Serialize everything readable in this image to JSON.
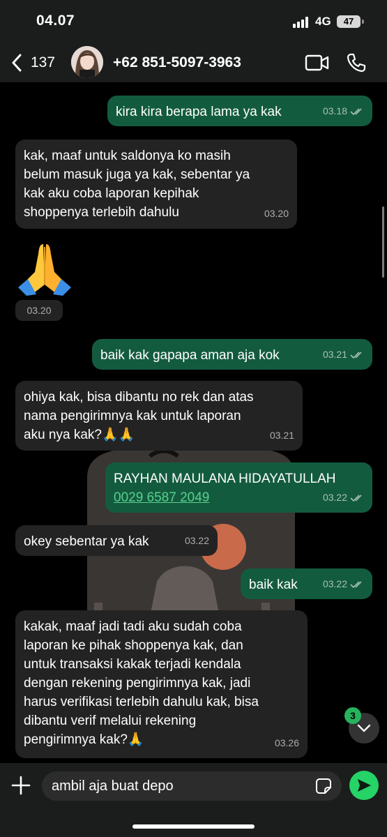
{
  "status_bar": {
    "time": "04.07",
    "network": "4G",
    "battery": "47"
  },
  "header": {
    "back_count": "137",
    "contact_name": "+62 851-5097-3963"
  },
  "messages": [
    {
      "dir": "out",
      "text": "kira kira berapa lama ya kak",
      "time": "03.18",
      "read": true
    },
    {
      "dir": "in",
      "lines": [
        "kak, maaf untuk saldonya ko masih",
        "belum masuk juga ya kak, sebentar ya",
        "kak aku coba laporan kepihak",
        "shoppenya terlebih dahulu"
      ],
      "time": "03.20"
    },
    {
      "dir": "in",
      "emoji": "folded-hands",
      "time": "03.20"
    },
    {
      "dir": "out",
      "text": "baik kak gapapa aman aja kok",
      "time": "03.21",
      "read": true
    },
    {
      "dir": "in",
      "lines": [
        "ohiya kak, bisa dibantu no rek dan atas",
        "nama pengirimnya kak untuk laporan",
        "aku nya kak?🙏🙏"
      ],
      "time": "03.21"
    },
    {
      "dir": "out",
      "text": "RAYHAN MAULANA HIDAYATULLAH",
      "link": "0029 6587 2049",
      "time": "03.22",
      "read": true
    },
    {
      "dir": "in",
      "text": "okey sebentar ya kak",
      "time": "03.22"
    },
    {
      "dir": "out",
      "text": "baik kak",
      "time": "03.22",
      "read": true
    },
    {
      "dir": "in",
      "lines": [
        "kakak, maaf jadi tadi aku sudah coba",
        "laporan ke pihak shoppenya kak, dan",
        "untuk transaksi kakak terjadi kendala",
        "dengan rekening pengirimnya kak, jadi",
        "harus verifikasi terlebih dahulu kak, bisa",
        "dibantu verif melalui rekening",
        "pengirimnya kak?🙏"
      ],
      "time": "03.26"
    }
  ],
  "unread_count": "3",
  "composer": {
    "value": "ambil aja buat depo"
  },
  "colors": {
    "outgoing": "#135b3f",
    "incoming": "#232323",
    "accent": "#25d366",
    "link": "#58d18d"
  },
  "icons": [
    "back-chevron-icon",
    "video-call-icon",
    "phone-icon",
    "double-check-icon",
    "chevron-down-icon",
    "plus-icon",
    "sticker-icon",
    "send-icon"
  ]
}
